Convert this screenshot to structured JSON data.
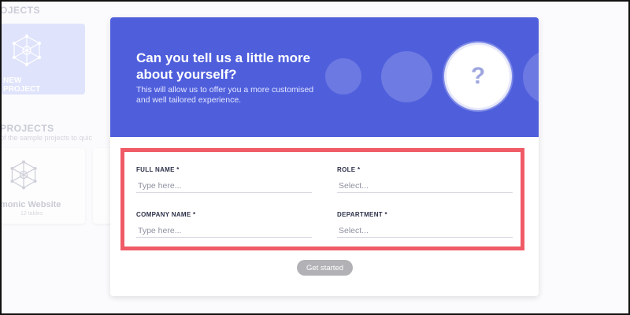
{
  "background": {
    "projects_heading": "OJECTS",
    "new_project_label": "NEW PROJECT",
    "sample_heading": "PROJECTS",
    "sample_subtitle": "of the sample projects to quic",
    "sample_card_title": "monic Website",
    "sample_card_meta": "12 tables"
  },
  "modal": {
    "title": "Can you tell us a little more about yourself?",
    "subtitle": "This will allow us to offer you a more customised and well tailored experience.",
    "question_mark": "?",
    "fields": {
      "full_name": {
        "label": "FULL NAME *",
        "placeholder": "Type here..."
      },
      "role": {
        "label": "ROLE *",
        "placeholder": "Select..."
      },
      "company_name": {
        "label": "COMPANY NAME *",
        "placeholder": "Type here..."
      },
      "department": {
        "label": "DEPARTMENT *",
        "placeholder": "Select..."
      }
    },
    "get_started_label": "Get started"
  },
  "colors": {
    "hero_bg": "#4f5fdc",
    "highlight_border": "#ef5b66",
    "button_disabled": "#b2b2b6",
    "new_project_card": "#dfe3fb"
  },
  "icons": [
    "network-icon",
    "question-mark-icon"
  ]
}
